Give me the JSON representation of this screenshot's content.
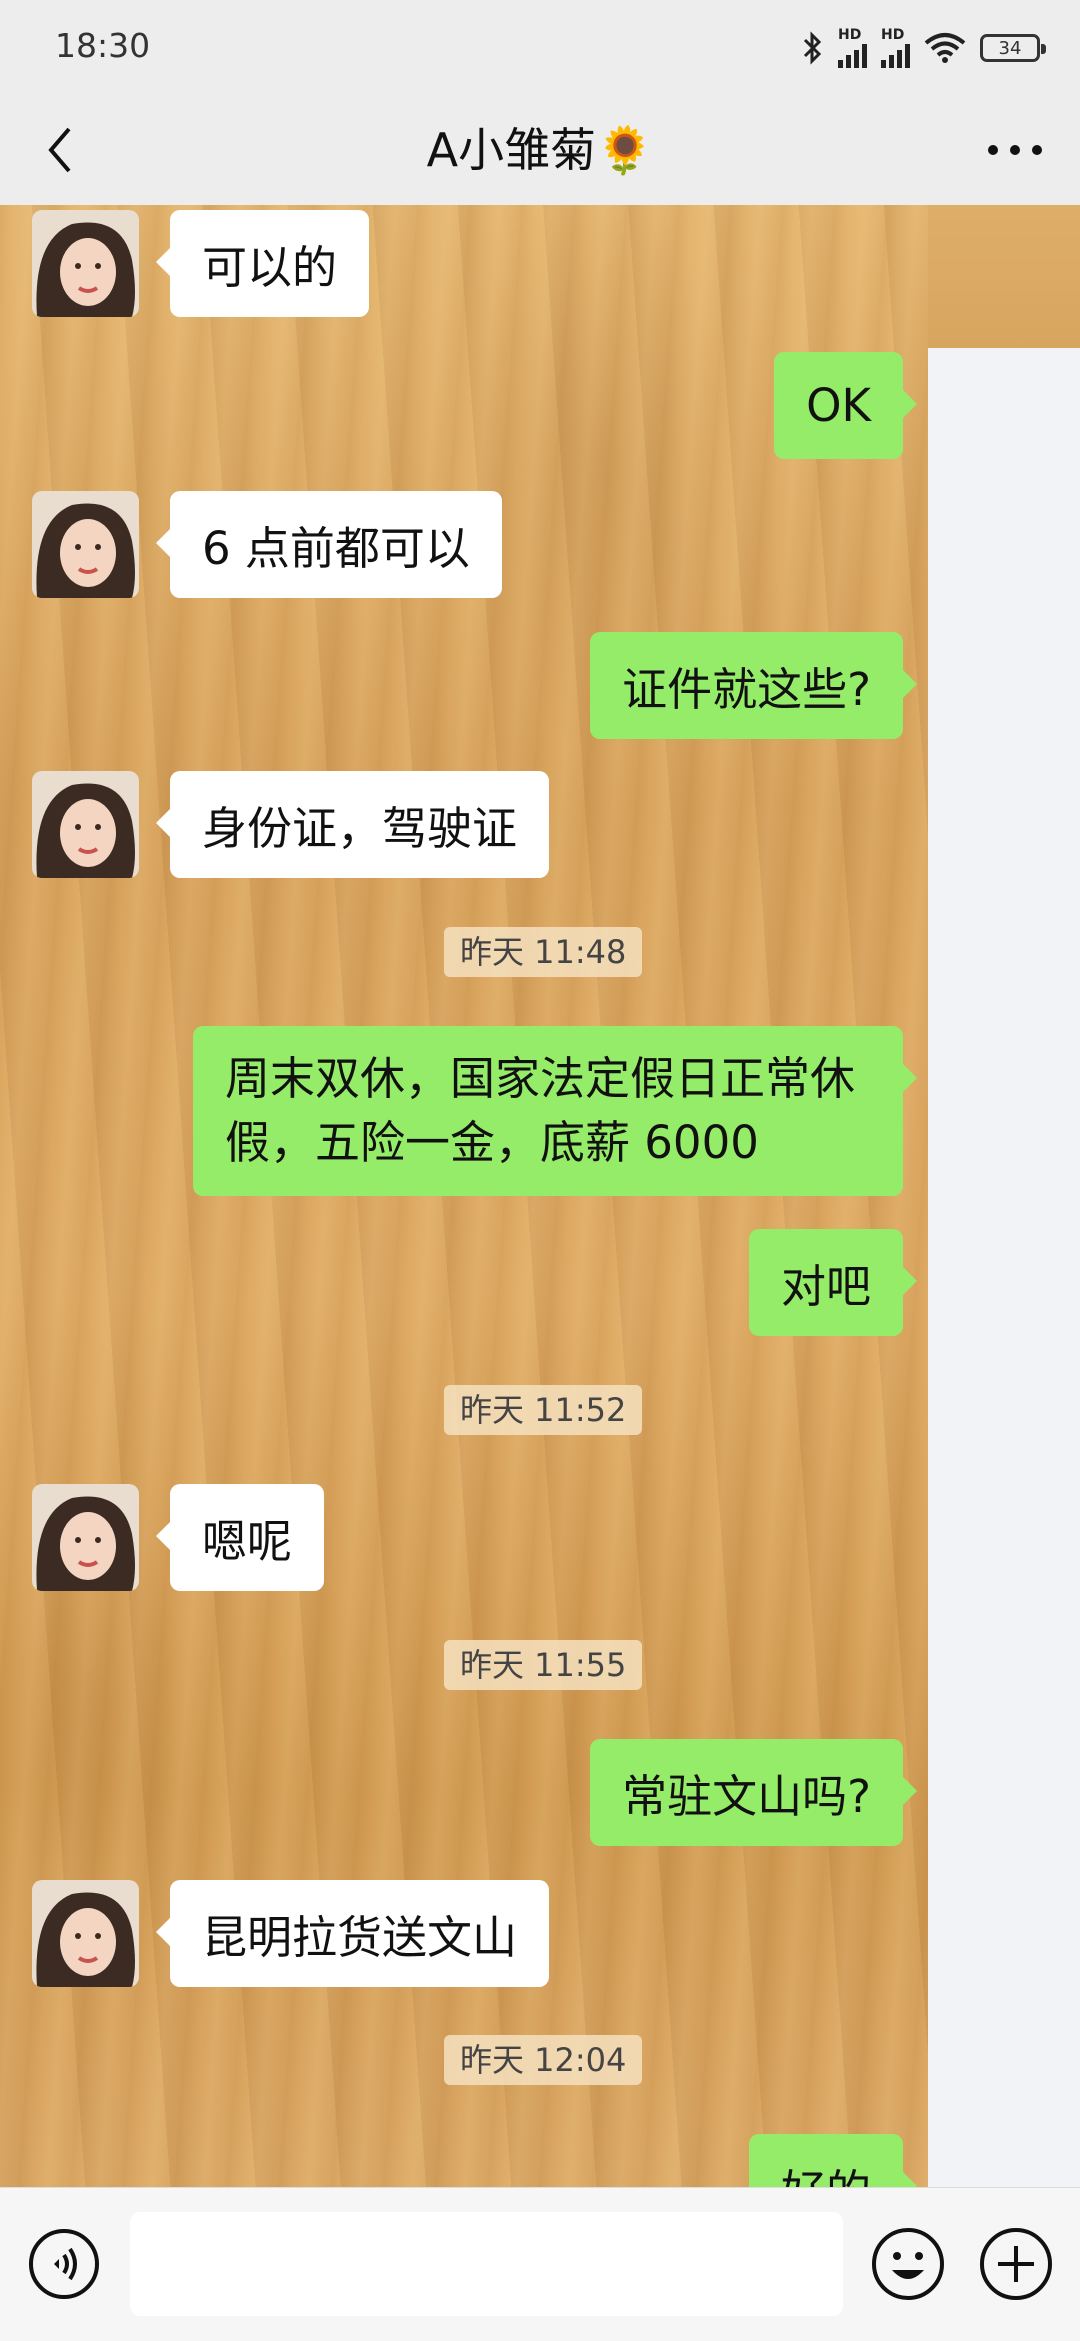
{
  "status_bar": {
    "time": "18:30",
    "hd_label_1": "HD",
    "hd_label_2": "HD",
    "battery": "34"
  },
  "nav": {
    "title": "A小雏菊🌻",
    "back_icon": "chevron-left-icon",
    "more_icon": "more-dots-icon"
  },
  "messages": [
    {
      "side": "in",
      "text": "可以的"
    },
    {
      "side": "out",
      "text": "OK"
    },
    {
      "side": "in",
      "text": "6 点前都可以"
    },
    {
      "side": "out",
      "text": "证件就这些?"
    },
    {
      "side": "in",
      "text": "身份证，驾驶证"
    },
    {
      "type": "time",
      "text": "昨天 11:48"
    },
    {
      "side": "out",
      "text": "周末双休，国家法定假日正常休假，五险一金，底薪 6000"
    },
    {
      "side": "out",
      "text": "对吧"
    },
    {
      "type": "time",
      "text": "昨天 11:52"
    },
    {
      "side": "in",
      "text": "嗯呢"
    },
    {
      "type": "time",
      "text": "昨天 11:55"
    },
    {
      "side": "out",
      "text": "常驻文山吗?"
    },
    {
      "side": "in",
      "text": "昆明拉货送文山"
    },
    {
      "type": "time",
      "text": "昨天 12:04"
    },
    {
      "side": "out",
      "text": "好的"
    }
  ],
  "input_bar": {
    "voice_icon": "voice-icon",
    "emoji_icon": "emoji-icon",
    "plus_icon": "plus-icon",
    "input_value": ""
  },
  "colors": {
    "outgoing_bubble": "#95ec69",
    "incoming_bubble": "#ffffff",
    "bar_background": "#ededed"
  }
}
